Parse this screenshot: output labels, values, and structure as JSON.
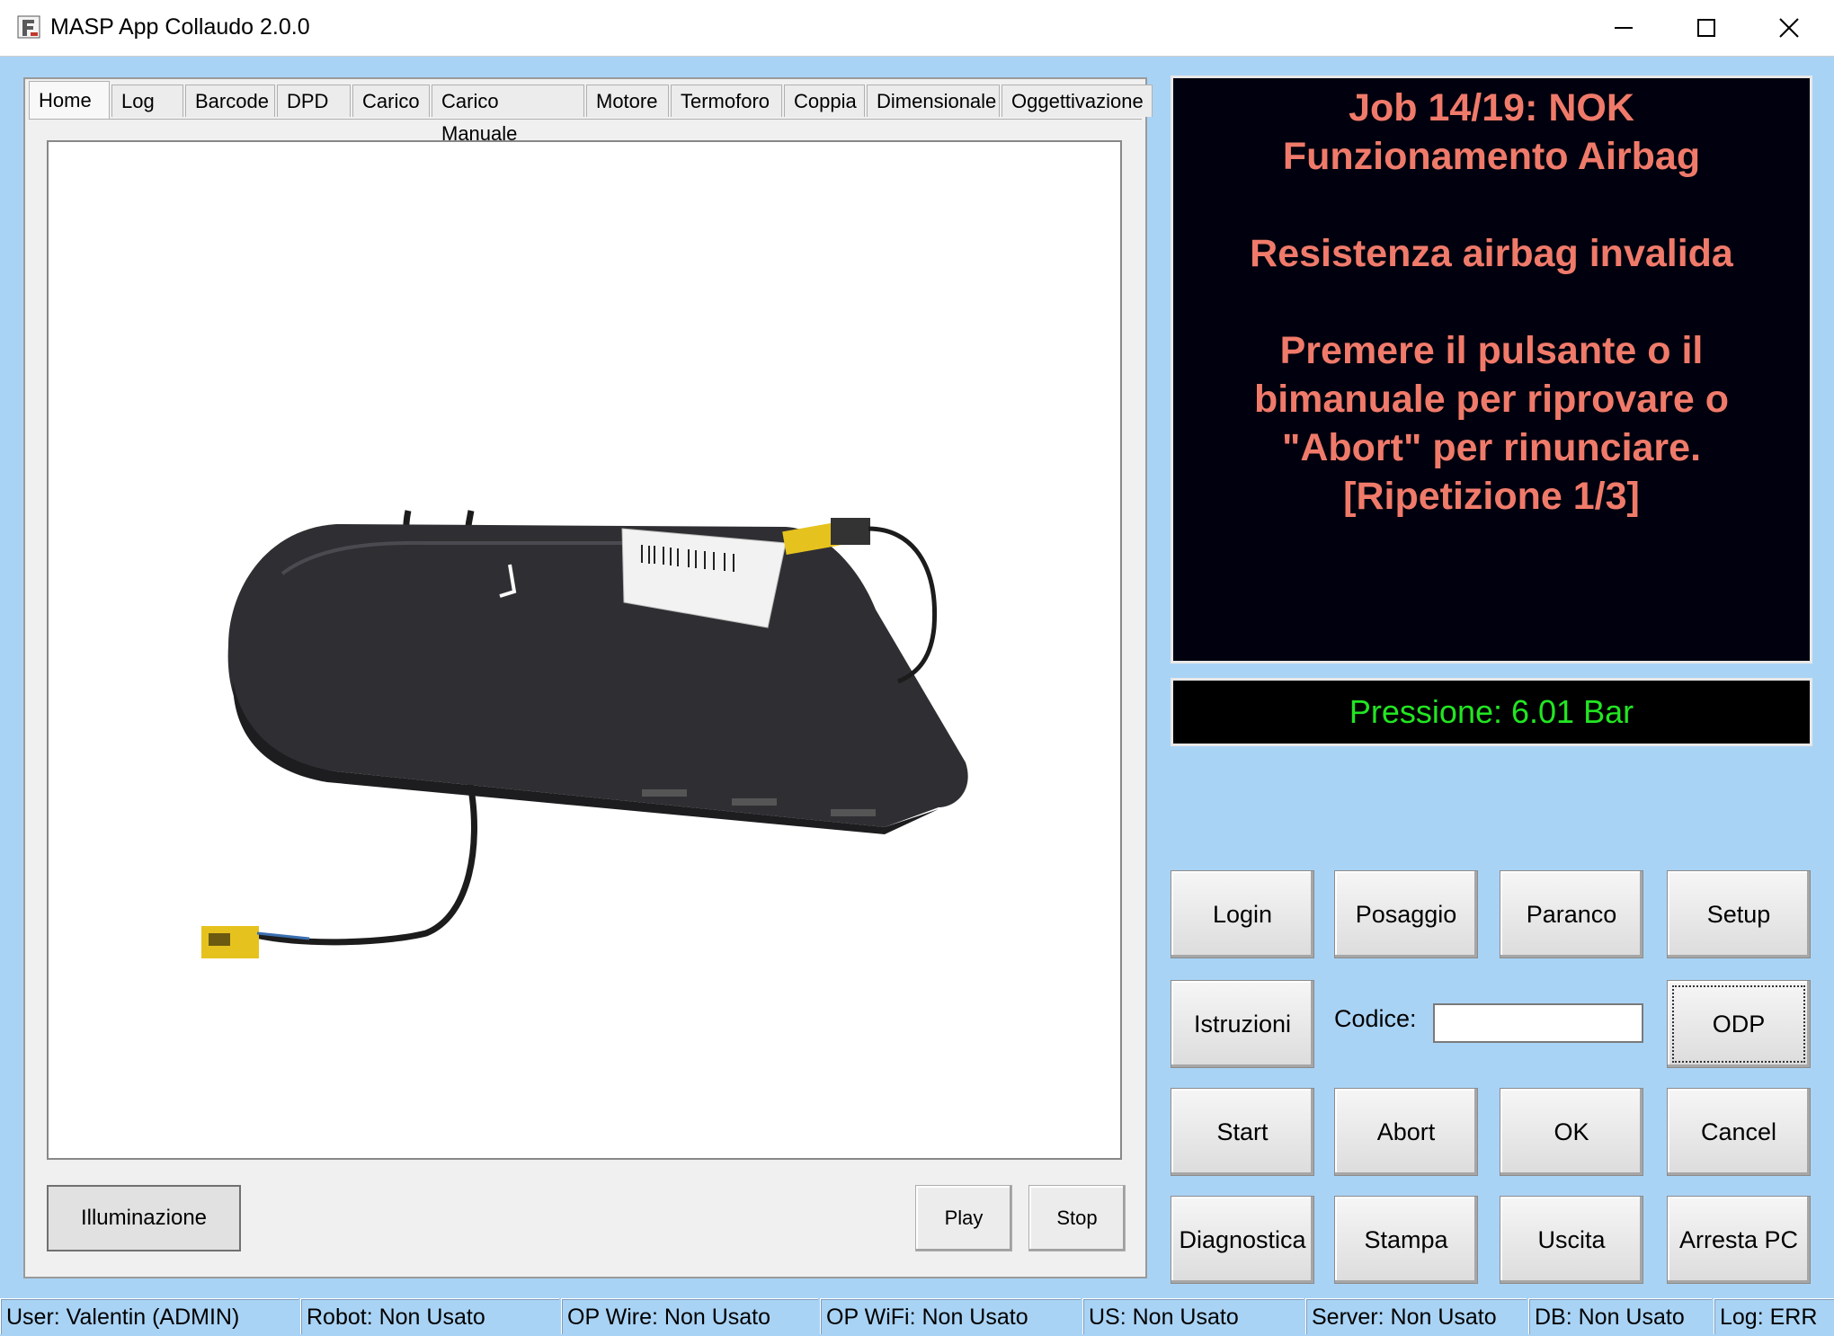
{
  "window": {
    "title": "MASP App Collaudo 2.0.0"
  },
  "tabs": [
    "Home",
    "Log",
    "Barcode",
    "DPD",
    "Carico",
    "Carico Manuale",
    "Motore",
    "Termoforo",
    "Coppia",
    "Dimensionale",
    "Oggettivazione"
  ],
  "active_tab": "Home",
  "left_panel": {
    "illuminazione_label": "Illuminazione",
    "play_label": "Play",
    "stop_label": "Stop"
  },
  "message": {
    "lines": [
      "Job 14/19: NOK",
      "Funzionamento Airbag",
      "",
      "Resistenza airbag invalida",
      "",
      "Premere il pulsante o il",
      "bimanuale per riprovare o",
      "\"Abort\" per rinunciare.",
      "[Ripetizione 1/3]"
    ],
    "color": "#f07a6a",
    "background": "#00000e"
  },
  "pressure": {
    "text": "Pressione: 6.01 Bar",
    "color": "#22e622"
  },
  "buttons": {
    "login": "Login",
    "posaggio": "Posaggio",
    "paranco": "Paranco",
    "setup": "Setup",
    "istruzioni": "Istruzioni",
    "odp": "ODP",
    "start": "Start",
    "abort": "Abort",
    "ok": "OK",
    "cancel": "Cancel",
    "diagnostica": "Diagnostica",
    "stampa": "Stampa",
    "uscita": "Uscita",
    "arresta_pc": "Arresta PC"
  },
  "codice": {
    "label": "Codice:",
    "value": ""
  },
  "status": {
    "user": "User: Valentin (ADMIN)",
    "robot": "Robot: Non Usato",
    "op_wire": "OP Wire: Non Usato",
    "op_wifi": "OP WiFi: Non Usato",
    "us": "US: Non Usato",
    "server": "Server: Non Usato",
    "db": "DB: Non Usato",
    "log": "Log: ERR"
  }
}
